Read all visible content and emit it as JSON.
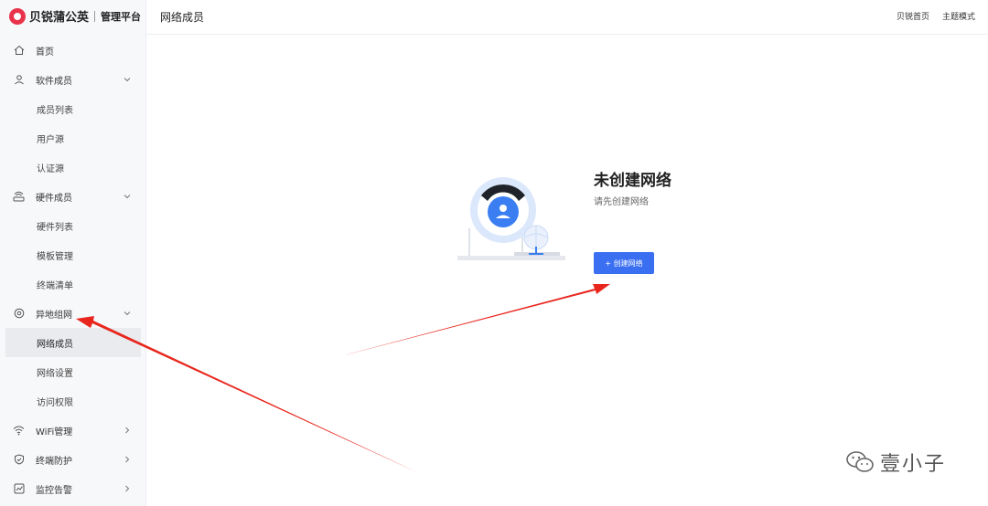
{
  "brand": {
    "name": "贝锐蒲公英",
    "sub": "管理平台"
  },
  "header": {
    "title": "网络成员",
    "links": [
      "贝锐首页",
      "主题模式"
    ]
  },
  "menu": {
    "home": "首页",
    "software": {
      "label": "软件成员",
      "items": [
        "成员列表",
        "用户源",
        "认证源"
      ]
    },
    "hardware": {
      "label": "硬件成员",
      "items": [
        "硬件列表",
        "模板管理",
        "终端清单"
      ]
    },
    "remote": {
      "label": "异地组网",
      "items": [
        "网络成员",
        "网络设置",
        "访问权限"
      ]
    },
    "wifi": "WiFi管理",
    "endpoint": "终端防护",
    "monitor": "监控告警"
  },
  "empty_state": {
    "title": "未创建网络",
    "description": "请先创建网络",
    "button": "+ 创建网络"
  },
  "watermark": {
    "text": "壹小子"
  },
  "colors": {
    "accent": "#3a6ff2",
    "annotation": "#e8261e",
    "brand": "#e8334a"
  }
}
